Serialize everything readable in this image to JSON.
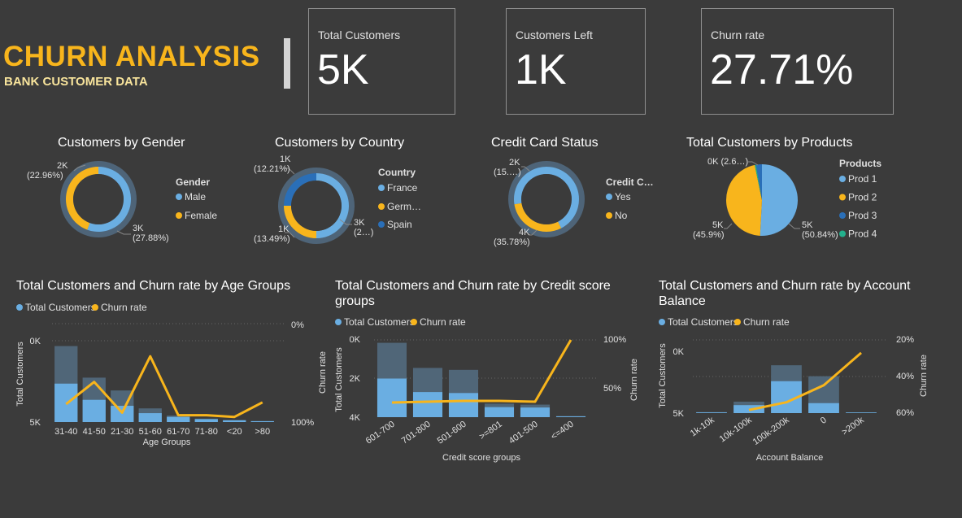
{
  "header": {
    "title": "CHURN ANALYSIS",
    "subtitle": "BANK CUSTOMER DATA"
  },
  "kpis": [
    {
      "label": "Total Customers",
      "value": "5K"
    },
    {
      "label": "Customers Left",
      "value": "1K"
    },
    {
      "label": "Churn rate",
      "value": "27.71%"
    }
  ],
  "colors": {
    "blue": "#6aaee2",
    "yellow": "#f8b51c",
    "darkblue": "#2a6fb8",
    "teal": "#23b08d",
    "totalbar": "#506678",
    "muted": "#4e6478",
    "background": "#3b3b3b",
    "accent": "#f8b51c"
  },
  "chart_data": [
    {
      "id": "gender",
      "type": "pie",
      "variant": "donut",
      "title": "Customers by Gender",
      "legend_title": "Gender",
      "series": [
        {
          "name": "Male",
          "value": 2.5,
          "label": "3K",
          "pct": "(27.88%)"
        },
        {
          "name": "Female",
          "value": 2.0,
          "label": "2K",
          "pct": "(22.96%)"
        }
      ]
    },
    {
      "id": "country",
      "type": "pie",
      "variant": "donut",
      "title": "Customers by Country",
      "legend_title": "Country",
      "series": [
        {
          "name": "France",
          "value": 2.5,
          "label": "3K",
          "pct": "(2…)"
        },
        {
          "name": "Germ…",
          "value": 1.25,
          "label": "1K",
          "pct": "(13.49%)"
        },
        {
          "name": "Spain",
          "value": 1.25,
          "label": "1K",
          "pct": "(12.21%)"
        }
      ]
    },
    {
      "id": "credit",
      "type": "pie",
      "variant": "donut",
      "title": "Credit Card Status",
      "legend_title": "Credit C…",
      "series": [
        {
          "name": "Yes",
          "value": 3.5,
          "label": "4K",
          "pct": "(35.78%)"
        },
        {
          "name": "No",
          "value": 1.5,
          "label": "2K",
          "pct": "(15.…)"
        }
      ]
    },
    {
      "id": "products",
      "type": "pie",
      "title": "Total Customers by Products",
      "legend_title": "Products",
      "series": [
        {
          "name": "Prod 1",
          "value": 50.84,
          "label": "5K",
          "pct": "(50.84%)"
        },
        {
          "name": "Prod 2",
          "value": 45.9,
          "label": "5K",
          "pct": "(45.9%)"
        },
        {
          "name": "Prod 3",
          "value": 2.66,
          "label": "0K",
          "pct": "(2.6…)"
        },
        {
          "name": "Prod 4",
          "value": 0.6
        }
      ]
    },
    {
      "id": "age",
      "type": "bar",
      "title": "Total Customers and Churn rate by Age Groups",
      "xlabel": "Age Groups",
      "ylabel": "Total Customers",
      "y2label": "",
      "categories": [
        "31-40",
        "41-50",
        "21-30",
        "51-60",
        "61-70",
        "71-80",
        "<20",
        ">80"
      ],
      "total": [
        4.45,
        2.6,
        1.85,
        0.8,
        0.38,
        0.2,
        0.12,
        0.06
      ],
      "retained": [
        2.25,
        1.3,
        0.95,
        0.52,
        0.3,
        0.17,
        0.1,
        0.05
      ],
      "churn": [
        21,
        47,
        11,
        77,
        8,
        8,
        6,
        23
      ],
      "ylim": [
        0,
        5
      ],
      "y2lim": [
        0,
        100
      ],
      "yticks": [
        "0K",
        "5K"
      ],
      "y2ticks": [
        "0%",
        "100%"
      ],
      "legend": [
        "Total Customers",
        "Churn rate"
      ]
    },
    {
      "id": "credit_score",
      "type": "bar",
      "title": "Total Customers and Churn rate by Credit score groups",
      "title_lines": [
        "Total Customers and Churn rate by Credit score",
        "groups"
      ],
      "xlabel": "Credit score groups",
      "ylabel": "Total Customers",
      "y2label": "Churn rate",
      "y3label": "Churn rate",
      "categories": [
        "601-700",
        "701-800",
        "501-600",
        ">=801",
        "401-500",
        "<=400"
      ],
      "total": [
        3.85,
        2.55,
        2.45,
        0.7,
        0.65,
        0.06
      ],
      "retained": [
        2.0,
        1.3,
        1.25,
        0.52,
        0.5,
        0.04
      ],
      "churn": [
        19,
        20,
        21,
        21,
        20,
        100
      ],
      "ylim": [
        0,
        4
      ],
      "y2lim": [
        0,
        100
      ],
      "yticks": [
        "0K",
        "2K",
        "4K"
      ],
      "y2ticks": [
        "50%",
        "100%"
      ],
      "legend": [
        "Total Customers",
        "Churn rate"
      ]
    },
    {
      "id": "balance",
      "type": "bar",
      "title": "Total Customers and Churn rate by Account Balance",
      "title_lines": [
        "Total Customers and Churn rate by Account",
        "Balance"
      ],
      "xlabel": "Account Balance",
      "ylabel": "Total Customers",
      "y2label": "Churn rate",
      "categories": [
        "1k-10k",
        "10k-100k",
        "100k-200k",
        "0",
        ">200k"
      ],
      "total": [
        0.1,
        1.15,
        4.8,
        3.7,
        0.08
      ],
      "retained": [
        0.07,
        0.8,
        3.2,
        1.0,
        0.06
      ],
      "churn": [
        null,
        22,
        27,
        38,
        59
      ],
      "ylim": [
        0,
        6.2
      ],
      "y2lim": [
        20,
        60
      ],
      "yticks": [
        "0K",
        "5K"
      ],
      "y2ticks": [
        "20%",
        "40%",
        "60%"
      ],
      "legend": [
        "Total Customers",
        "Churn rate"
      ]
    }
  ]
}
